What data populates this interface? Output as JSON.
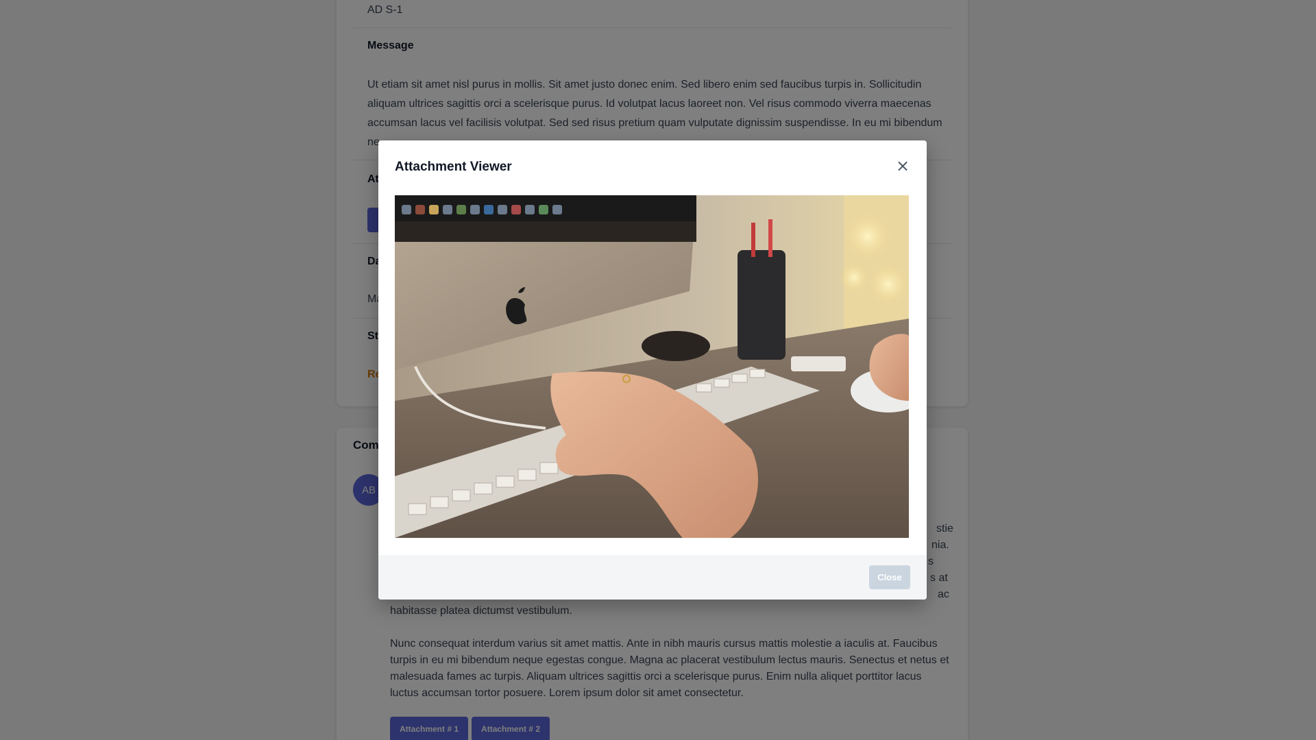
{
  "ticket": {
    "reference": "AD S-1",
    "message_label": "Message",
    "message_text": "Ut etiam sit amet nisl purus in mollis. Sit amet justo donec enim. Sed libero enim sed faucibus turpis in. Sollicitudin aliquam ultrices sagittis orci a scelerisque purus. Id volutpat lacus laoreet non. Vel risus commodo viverra maecenas accumsan lacus vel facilisis volutpat. Sed sed risus pretium quam vulputate dignissim suspendisse. In eu mi bibendum ne",
    "attachments_label_fragment": "At",
    "date_label_fragment": "Da",
    "date_value_fragment": "Ma",
    "status_label_fragment": "St",
    "status_value_fragment": "Re"
  },
  "comments": {
    "title_fragment": "Com",
    "avatar_initials": "AB",
    "right_fragments": [
      "stie",
      "nia.",
      "s",
      "s at",
      "ac"
    ],
    "paragraph1_end": "habitasse platea dictumst vestibulum.",
    "paragraph2": "Nunc consequat interdum varius sit amet mattis. Ante in nibh mauris cursus mattis molestie a iaculis at. Faucibus turpis in eu mi bibendum neque egestas congue. Magna ac placerat vestibulum lectus mauris. Senectus et netus et malesuada fames ac turpis. Aliquam ultrices sagittis orci a scelerisque purus. Enim nulla aliquet porttitor lacus luctus accumsan tortor posuere. Lorem ipsum dolor sit amet consectetur.",
    "attachments": [
      "Attachment # 1",
      "Attachment # 2"
    ]
  },
  "modal": {
    "title": "Attachment Viewer",
    "close_icon": "×",
    "close_button": "Close",
    "image_icon": "photo-of-hand-typing-on-keyboard"
  },
  "colors": {
    "accent": "#5a67d8",
    "status": "#d97706",
    "backdrop": "rgba(0,0,0,0.5)",
    "footer_button": "#cbd5e0"
  }
}
